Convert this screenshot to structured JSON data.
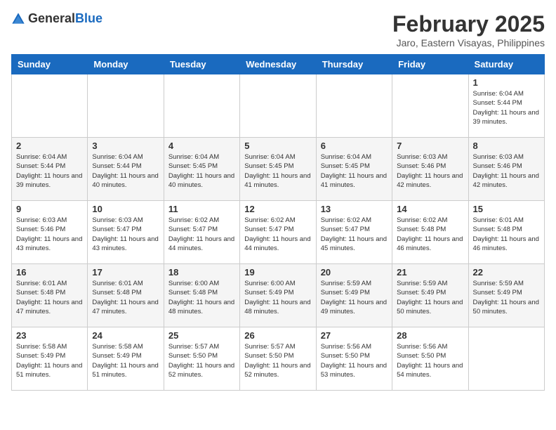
{
  "header": {
    "logo_general": "General",
    "logo_blue": "Blue",
    "month_title": "February 2025",
    "location": "Jaro, Eastern Visayas, Philippines"
  },
  "days_of_week": [
    "Sunday",
    "Monday",
    "Tuesday",
    "Wednesday",
    "Thursday",
    "Friday",
    "Saturday"
  ],
  "weeks": [
    [
      {
        "day": "",
        "info": ""
      },
      {
        "day": "",
        "info": ""
      },
      {
        "day": "",
        "info": ""
      },
      {
        "day": "",
        "info": ""
      },
      {
        "day": "",
        "info": ""
      },
      {
        "day": "",
        "info": ""
      },
      {
        "day": "1",
        "info": "Sunrise: 6:04 AM\nSunset: 5:44 PM\nDaylight: 11 hours and 39 minutes."
      }
    ],
    [
      {
        "day": "2",
        "info": "Sunrise: 6:04 AM\nSunset: 5:44 PM\nDaylight: 11 hours and 39 minutes."
      },
      {
        "day": "3",
        "info": "Sunrise: 6:04 AM\nSunset: 5:44 PM\nDaylight: 11 hours and 40 minutes."
      },
      {
        "day": "4",
        "info": "Sunrise: 6:04 AM\nSunset: 5:45 PM\nDaylight: 11 hours and 40 minutes."
      },
      {
        "day": "5",
        "info": "Sunrise: 6:04 AM\nSunset: 5:45 PM\nDaylight: 11 hours and 41 minutes."
      },
      {
        "day": "6",
        "info": "Sunrise: 6:04 AM\nSunset: 5:45 PM\nDaylight: 11 hours and 41 minutes."
      },
      {
        "day": "7",
        "info": "Sunrise: 6:03 AM\nSunset: 5:46 PM\nDaylight: 11 hours and 42 minutes."
      },
      {
        "day": "8",
        "info": "Sunrise: 6:03 AM\nSunset: 5:46 PM\nDaylight: 11 hours and 42 minutes."
      }
    ],
    [
      {
        "day": "9",
        "info": "Sunrise: 6:03 AM\nSunset: 5:46 PM\nDaylight: 11 hours and 43 minutes."
      },
      {
        "day": "10",
        "info": "Sunrise: 6:03 AM\nSunset: 5:47 PM\nDaylight: 11 hours and 43 minutes."
      },
      {
        "day": "11",
        "info": "Sunrise: 6:02 AM\nSunset: 5:47 PM\nDaylight: 11 hours and 44 minutes."
      },
      {
        "day": "12",
        "info": "Sunrise: 6:02 AM\nSunset: 5:47 PM\nDaylight: 11 hours and 44 minutes."
      },
      {
        "day": "13",
        "info": "Sunrise: 6:02 AM\nSunset: 5:47 PM\nDaylight: 11 hours and 45 minutes."
      },
      {
        "day": "14",
        "info": "Sunrise: 6:02 AM\nSunset: 5:48 PM\nDaylight: 11 hours and 46 minutes."
      },
      {
        "day": "15",
        "info": "Sunrise: 6:01 AM\nSunset: 5:48 PM\nDaylight: 11 hours and 46 minutes."
      }
    ],
    [
      {
        "day": "16",
        "info": "Sunrise: 6:01 AM\nSunset: 5:48 PM\nDaylight: 11 hours and 47 minutes."
      },
      {
        "day": "17",
        "info": "Sunrise: 6:01 AM\nSunset: 5:48 PM\nDaylight: 11 hours and 47 minutes."
      },
      {
        "day": "18",
        "info": "Sunrise: 6:00 AM\nSunset: 5:48 PM\nDaylight: 11 hours and 48 minutes."
      },
      {
        "day": "19",
        "info": "Sunrise: 6:00 AM\nSunset: 5:49 PM\nDaylight: 11 hours and 48 minutes."
      },
      {
        "day": "20",
        "info": "Sunrise: 5:59 AM\nSunset: 5:49 PM\nDaylight: 11 hours and 49 minutes."
      },
      {
        "day": "21",
        "info": "Sunrise: 5:59 AM\nSunset: 5:49 PM\nDaylight: 11 hours and 50 minutes."
      },
      {
        "day": "22",
        "info": "Sunrise: 5:59 AM\nSunset: 5:49 PM\nDaylight: 11 hours and 50 minutes."
      }
    ],
    [
      {
        "day": "23",
        "info": "Sunrise: 5:58 AM\nSunset: 5:49 PM\nDaylight: 11 hours and 51 minutes."
      },
      {
        "day": "24",
        "info": "Sunrise: 5:58 AM\nSunset: 5:49 PM\nDaylight: 11 hours and 51 minutes."
      },
      {
        "day": "25",
        "info": "Sunrise: 5:57 AM\nSunset: 5:50 PM\nDaylight: 11 hours and 52 minutes."
      },
      {
        "day": "26",
        "info": "Sunrise: 5:57 AM\nSunset: 5:50 PM\nDaylight: 11 hours and 52 minutes."
      },
      {
        "day": "27",
        "info": "Sunrise: 5:56 AM\nSunset: 5:50 PM\nDaylight: 11 hours and 53 minutes."
      },
      {
        "day": "28",
        "info": "Sunrise: 5:56 AM\nSunset: 5:50 PM\nDaylight: 11 hours and 54 minutes."
      },
      {
        "day": "",
        "info": ""
      }
    ]
  ]
}
